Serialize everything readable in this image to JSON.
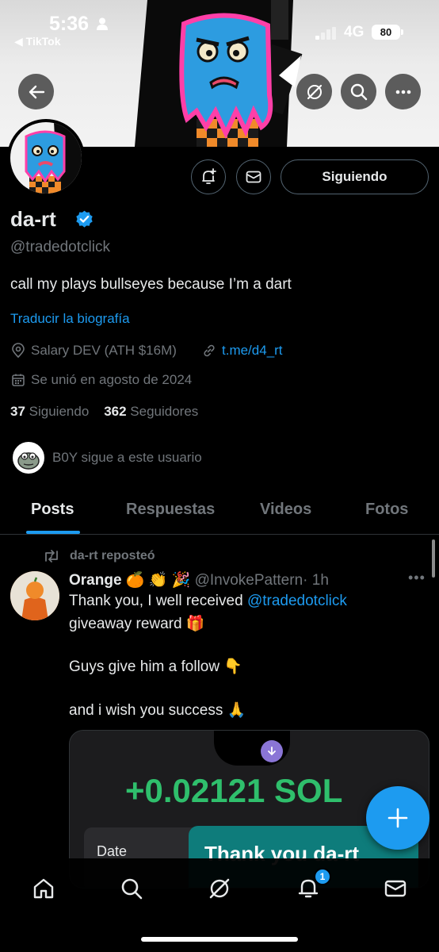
{
  "status": {
    "time": "5:36",
    "back_app": "◀ TikTok",
    "network": "4G",
    "battery": "80"
  },
  "profile": {
    "name": "da-rt",
    "handle": "@tradedotclick",
    "bio": "call my plays bullseyes because I’m a dart",
    "translate": "Traducir la biografía",
    "location": "Salary DEV (ATH $16M)",
    "link": "t.me/d4_rt",
    "joined": "Se unió en agosto de 2024",
    "following_count": "37",
    "following_label": "Siguiendo",
    "followers_count": "362",
    "followers_label": "Seguidores",
    "followed_by": "B0Y sigue a este usuario",
    "follow_button": "Siguiendo"
  },
  "tabs": [
    "Posts",
    "Respuestas",
    "Videos",
    "Fotos"
  ],
  "post": {
    "repost_label": "da-rt reposteó",
    "author": "Orange 🍊 👏 🎉",
    "author_handle": "@InvokePattern",
    "time": "· 1h",
    "line1_pre": "Thank you, I well received ",
    "line1_mention": "@tradedotclick",
    "line2": "giveaway reward 🎁",
    "line3": "Guys give him a follow 👇",
    "line4": "and i wish you success 🙏",
    "media_amount": "+0.02121 SOL",
    "media_date": "Date",
    "media_thanks": "Thank you da-rt"
  },
  "nav": {
    "notifications_badge": "1"
  },
  "colors": {
    "accent": "#1d9bf0",
    "muted": "#71767b",
    "text": "#e7e9ea",
    "sol_green": "#2fbf6c"
  }
}
